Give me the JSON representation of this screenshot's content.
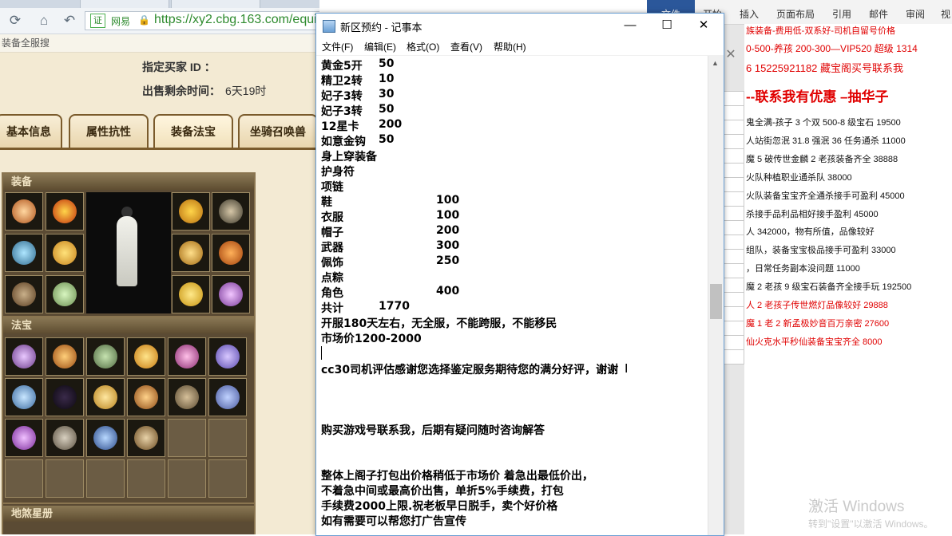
{
  "browser": {
    "url": "https://xy2.cbg.163.com/equip",
    "site_name": "网易",
    "cert_label": "证",
    "bookmark": "装备全服搜",
    "buyer_label": "指定买家 ID ：",
    "time_label": "出售剩余时间：",
    "time_value": "6天19时",
    "tabs": [
      "基本信息",
      "属性抗性",
      "装备法宝",
      "坐骑召唤兽"
    ],
    "active_tab": "装备法宝",
    "equip_title": "装备",
    "fabao_title": "法宝",
    "star_title": "地煞星册"
  },
  "word": {
    "tabs": [
      "文件",
      "开始",
      "插入",
      "页面布局",
      "引用",
      "邮件",
      "审阅",
      "视"
    ],
    "lines": [
      {
        "text": "族装备-费用低-双系好-司机自留号价格",
        "style": "red"
      },
      {
        "text": "0-500-养孩 200-300—VIP520 超级 1314",
        "style": "red"
      },
      {
        "text": "6   15225921182  藏宝阁买号联系我",
        "style": "mid"
      },
      {
        "text": "--联系我有优惠 –抽华子",
        "style": "big"
      },
      {
        "text": "鬼全满-孩子 3 个双 500-8 级宝石 19500",
        "style": ""
      },
      {
        "text": "人站街忽泯 31.8 强泯 36 任务通杀 11000",
        "style": ""
      },
      {
        "text": "魔 5 破传世金麟 2 老孩装备齐全 38888",
        "style": ""
      },
      {
        "text": "火队种植职业通杀队 38000",
        "style": ""
      },
      {
        "text": "火队装备宝宝齐全通杀接手可盈利 45000",
        "style": ""
      },
      {
        "text": "杀接手品利品相好接手盈利 45000",
        "style": ""
      },
      {
        "text": "人 342000，物有所值，品像较好",
        "style": ""
      },
      {
        "text": "组队，装备宝宝极品接手可盈利 33000",
        "style": ""
      },
      {
        "text": "，日常任务副本没问题 11000",
        "style": ""
      },
      {
        "text": "魔 2 老孩 9 级宝石装备齐全接手玩 192500",
        "style": ""
      },
      {
        "text": "人 2 老孩子传世燃灯品像较好 29888",
        "style": "red"
      },
      {
        "text": "魔 1 老 2 新孟极妙音百万亲密 27600",
        "style": "red"
      },
      {
        "text": "仙火克水平秒仙装备宝宝齐全 8000",
        "style": "red"
      }
    ],
    "activate_main": "激活 Windows",
    "activate_sub": "转到\"设置\"以激活 Windows。"
  },
  "notepad": {
    "title": "新区预约 - 记事本",
    "menu": [
      "文件(F)",
      "编辑(E)",
      "格式(O)",
      "查看(V)",
      "帮助(H)"
    ],
    "window_controls": {
      "minimize": "—",
      "maximize": "☐",
      "close": "✕"
    },
    "lines": [
      {
        "a": "黄金5开",
        "b": "50",
        "c": ""
      },
      {
        "a": "精卫2转",
        "b": "10",
        "c": ""
      },
      {
        "a": "妃子3转",
        "b": "30",
        "c": ""
      },
      {
        "a": "妃子3转",
        "b": "50",
        "c": ""
      },
      {
        "a": "12星卡",
        "b": "200",
        "c": ""
      },
      {
        "a": "如意金钩",
        "b": "50",
        "c": ""
      },
      {
        "a": "身上穿装备",
        "b": "",
        "c": ""
      },
      {
        "a": "护身符",
        "b": "",
        "c": ""
      },
      {
        "a": "项链",
        "b": "",
        "c": ""
      },
      {
        "a": "鞋",
        "b": "",
        "c": "100"
      },
      {
        "a": "衣服",
        "b": "",
        "c": "100"
      },
      {
        "a": "帽子",
        "b": "",
        "c": "200"
      },
      {
        "a": "武器",
        "b": "",
        "c": "300"
      },
      {
        "a": "佩饰",
        "b": "",
        "c": "250"
      },
      {
        "a": "点粽",
        "b": "",
        "c": ""
      },
      {
        "a": "角色",
        "b": "",
        "c": "400"
      },
      {
        "a": "共计",
        "b": "1770",
        "c": ""
      },
      {
        "a": "开服180天左右，无全服，不能跨服，不能移民",
        "b": "",
        "c": ""
      },
      {
        "a": "市场价1200-2000",
        "b": "",
        "c": ""
      }
    ],
    "evaluation": "cc30司机评估感谢您选择鉴定服务期待您的满分好评，谢谢",
    "contact": "购买游戏号联系我，后期有疑问随时咨询解答",
    "closing": [
      "整体上阁子打包出价格稍低于市场价 着急出最低价出，",
      "不着急中间或最高价出售，单折5%手续费，打包",
      "手续费2000上限.祝老板早日脱手，卖个好价格",
      "如有需要可以帮您打广告宣传"
    ]
  }
}
